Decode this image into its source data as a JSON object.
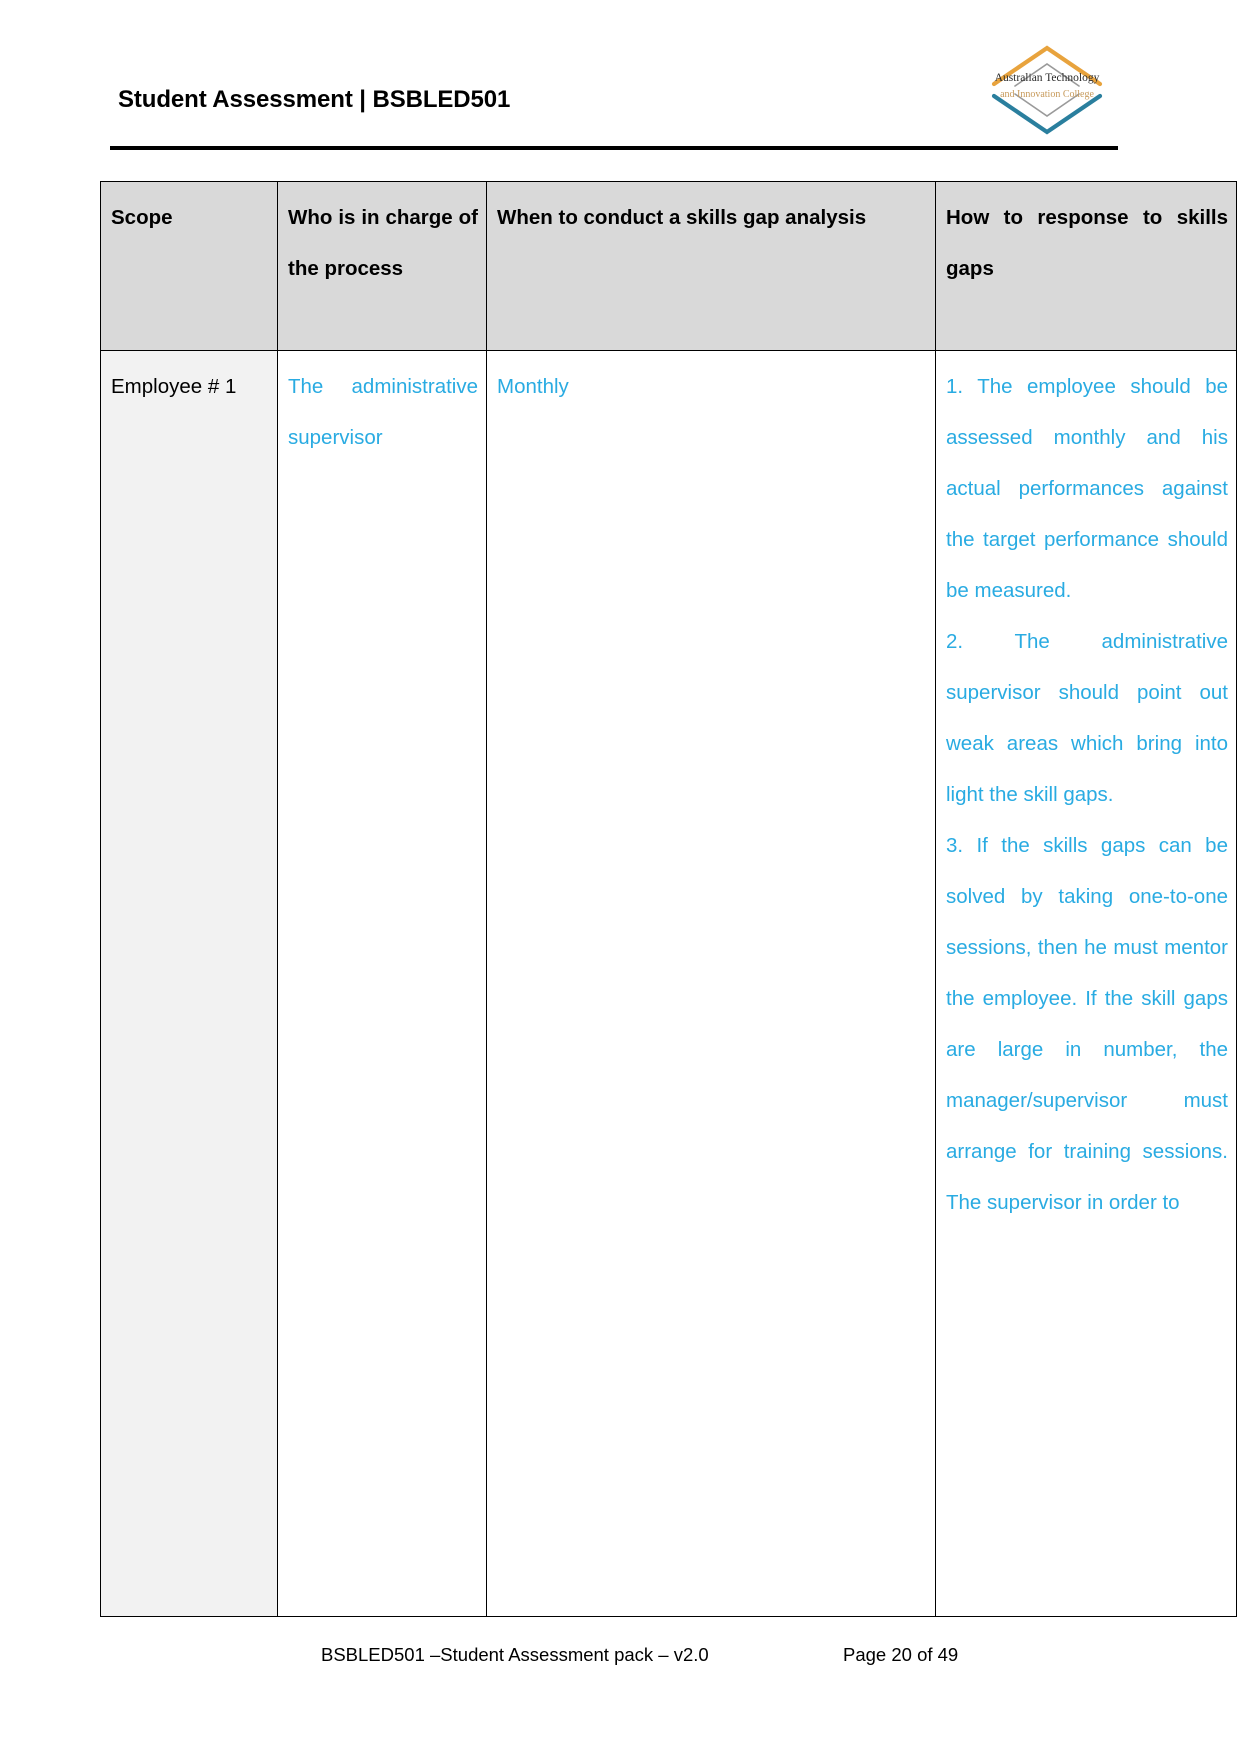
{
  "header": {
    "title": "Student Assessment | BSBLED501",
    "logo": {
      "line1": "Australian Technology",
      "line2": "and Innovation College",
      "top_chevron_color": "#e8a33d",
      "bottom_chevron_color": "#2a7f9e",
      "inner_chevron_color": "#9a9a9a"
    }
  },
  "table": {
    "columns": [
      {
        "key": "scope",
        "header": "Scope"
      },
      {
        "key": "who",
        "header": "Who is in charge of the process"
      },
      {
        "key": "when",
        "header": "When to conduct a skills gap analysis"
      },
      {
        "key": "how",
        "header": "How to response to skills gaps"
      }
    ],
    "rows": [
      {
        "scope": "Employee # 1",
        "who": "The administrative supervisor",
        "when": "Monthly",
        "how_items": [
          "1. The employee should be assessed monthly and his actual performances against the target performance should be measured.",
          "2. The administrative supervisor should point out weak areas which bring into light the skill gaps.",
          "3. If the skills gaps can be solved by taking one-to-one sessions, then he must mentor the employee. If the skill gaps are large in number, the manager/supervisor must arrange for training sessions. The supervisor in order to"
        ]
      }
    ],
    "body_text_color": "#29abe2",
    "header_bg": "#d9d9d9",
    "scope_cell_bg": "#f2f2f2"
  },
  "footer": {
    "left": "BSBLED501 –Student Assessment pack – v2.0",
    "right": "Page 20 of 49"
  }
}
